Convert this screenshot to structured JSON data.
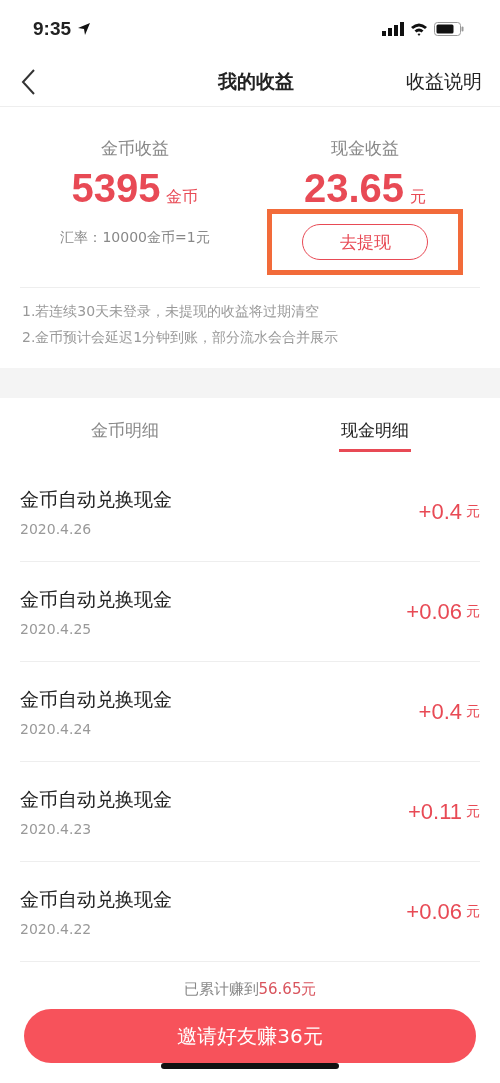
{
  "status_bar": {
    "time": "9:35"
  },
  "nav": {
    "title": "我的收益",
    "action": "收益说明"
  },
  "summary": [
    {
      "label": "金币收益",
      "amount": "5395",
      "unit": "金币",
      "kind": "rate",
      "note": "汇率：10000金币=1元"
    },
    {
      "label": "现金收益",
      "amount": "23.65",
      "unit": "元",
      "kind": "button",
      "button": {
        "label": "去提现",
        "highlighted": true
      }
    }
  ],
  "notes": [
    "1.若连续30天未登录，未提现的收益将过期清空",
    "2.金币预计会延迟1分钟到账，部分流水会合并展示"
  ],
  "tabs": [
    {
      "label": "金币明细",
      "selected": false
    },
    {
      "label": "现金明细",
      "selected": true
    }
  ],
  "rows": [
    {
      "title": "金币自动兑换现金",
      "date": "2020.4.26",
      "amount": "+0.4",
      "unit": "元"
    },
    {
      "title": "金币自动兑换现金",
      "date": "2020.4.25",
      "amount": "+0.06",
      "unit": "元"
    },
    {
      "title": "金币自动兑换现金",
      "date": "2020.4.24",
      "amount": "+0.4",
      "unit": "元"
    },
    {
      "title": "金币自动兑换现金",
      "date": "2020.4.23",
      "amount": "+0.11",
      "unit": "元"
    },
    {
      "title": "金币自动兑换现金",
      "date": "2020.4.22",
      "amount": "+0.06",
      "unit": "元"
    }
  ],
  "footer": {
    "total_label": "已累计赚到",
    "total_amount": "56.65元",
    "button": "邀请好友赚36元"
  }
}
